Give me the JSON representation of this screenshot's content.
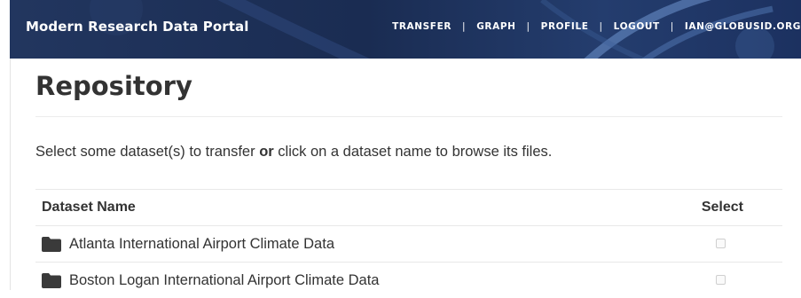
{
  "header": {
    "brand": "Modern Research Data Portal",
    "nav": [
      {
        "label": "TRANSFER"
      },
      {
        "label": "GRAPH"
      },
      {
        "label": "PROFILE"
      },
      {
        "label": "LOGOUT"
      },
      {
        "label": "IAN@GLOBUSID.ORG"
      }
    ],
    "separator": "|",
    "background_color": "#1b2e55"
  },
  "page": {
    "title": "Repository",
    "instructions": {
      "before": "Select some dataset(s) to transfer ",
      "emphasis": "or",
      "after": " click on a dataset name to browse its files."
    }
  },
  "table": {
    "columns": {
      "name": "Dataset Name",
      "select": "Select"
    },
    "rows": [
      {
        "name": "Atlanta International Airport Climate Data",
        "selected": false,
        "icon": "folder-icon"
      },
      {
        "name": "Boston Logan International Airport Climate Data",
        "selected": false,
        "icon": "folder-icon"
      }
    ]
  }
}
